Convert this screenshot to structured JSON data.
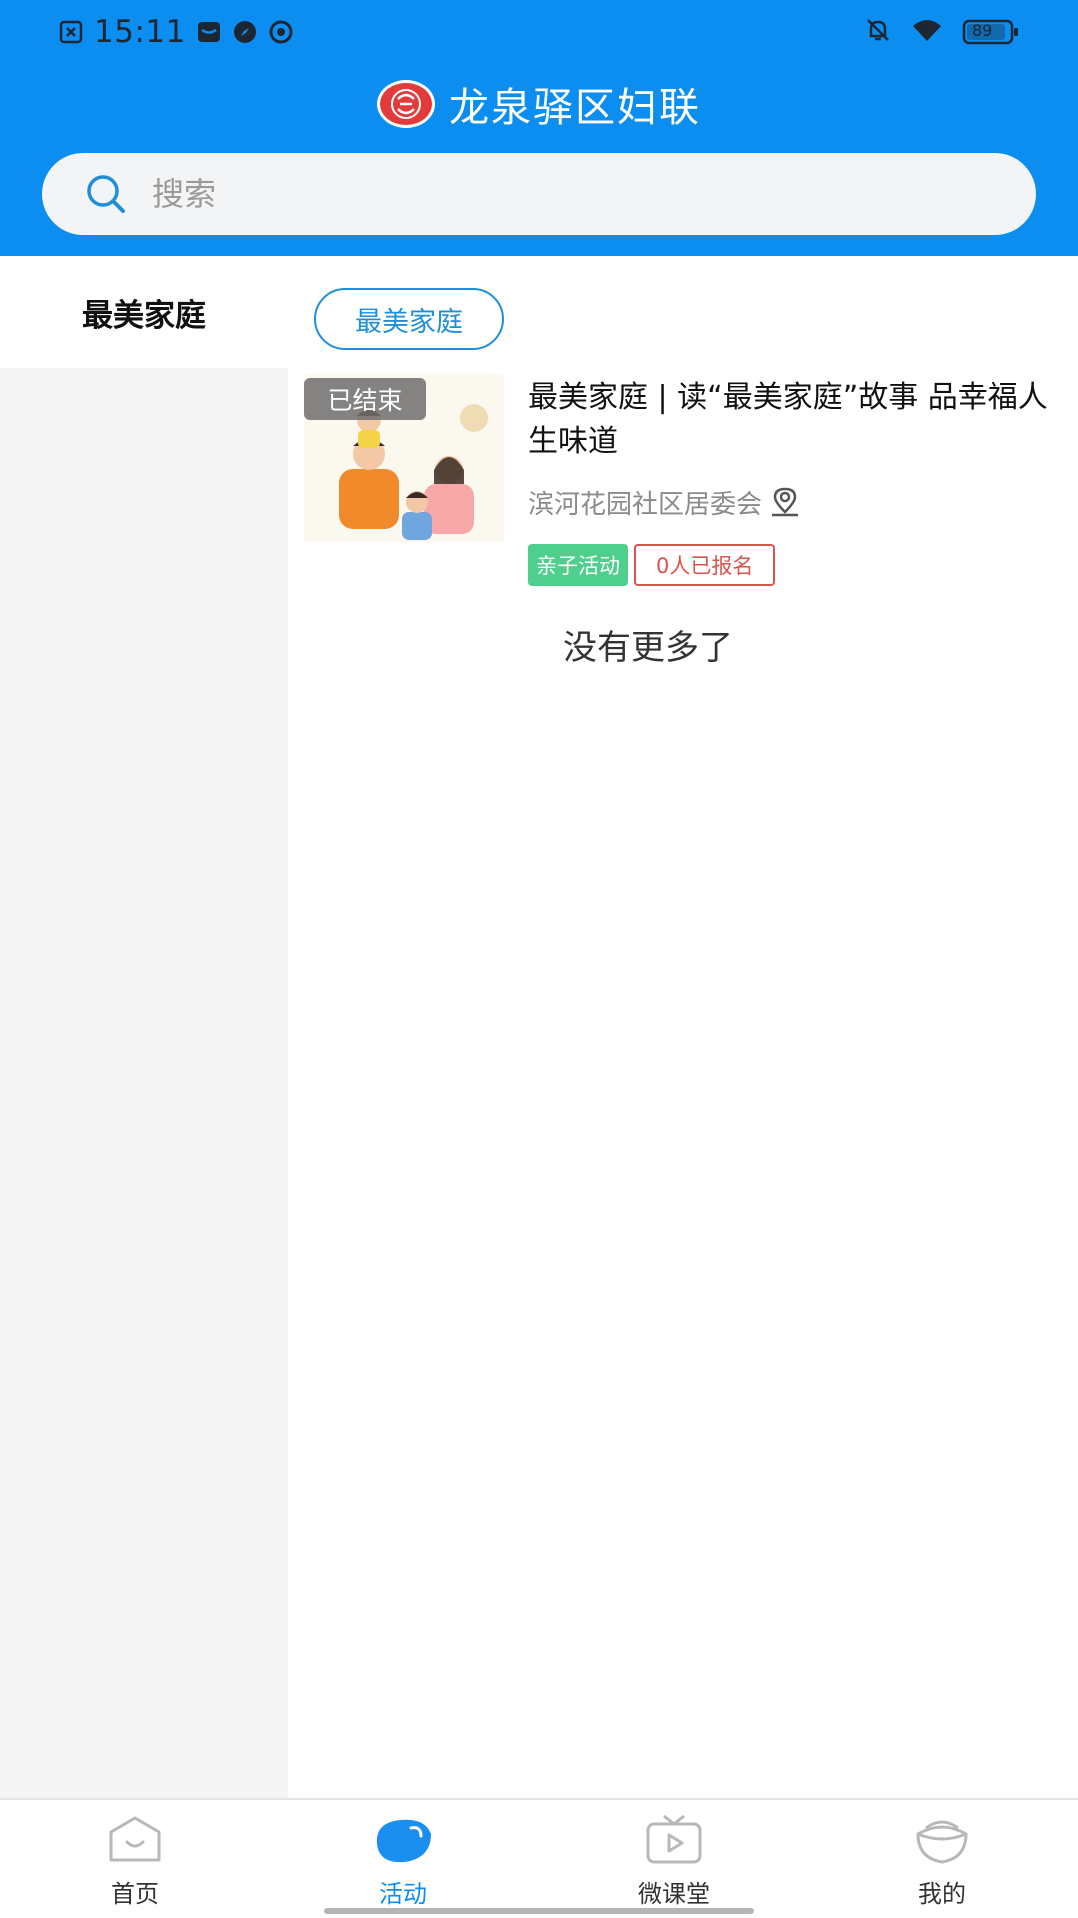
{
  "status_bar": {
    "time": "15:11",
    "battery": "89",
    "icons": [
      "close-box-icon",
      "mail-icon",
      "compass-icon",
      "circle-check-icon",
      "bell-off-icon",
      "wifi-icon",
      "battery-icon"
    ]
  },
  "header": {
    "title": "龙泉驿区妇联",
    "logo": "women-federation-logo",
    "accent_color": "#0b8ef0"
  },
  "search": {
    "placeholder": "搜索"
  },
  "sidebar": {
    "items": [
      {
        "label": "最美家庭",
        "selected": true
      }
    ]
  },
  "main": {
    "filter_chip": "最美家庭",
    "cards": [
      {
        "title": "最美家庭 | 读“最美家庭”故事 品幸福人生味道",
        "status_badge": "已结束",
        "organization": "滨河花园社区居委会",
        "tags": [
          "亲子活动",
          "0人已报名"
        ]
      }
    ],
    "end_text": "没有更多了"
  },
  "tabbar": {
    "tabs": [
      {
        "label": "首页",
        "icon": "home-icon",
        "active": false
      },
      {
        "label": "活动",
        "icon": "activity-icon",
        "active": true
      },
      {
        "label": "微课堂",
        "icon": "tv-play-icon",
        "active": false
      },
      {
        "label": "我的",
        "icon": "profile-icon",
        "active": false
      }
    ]
  }
}
